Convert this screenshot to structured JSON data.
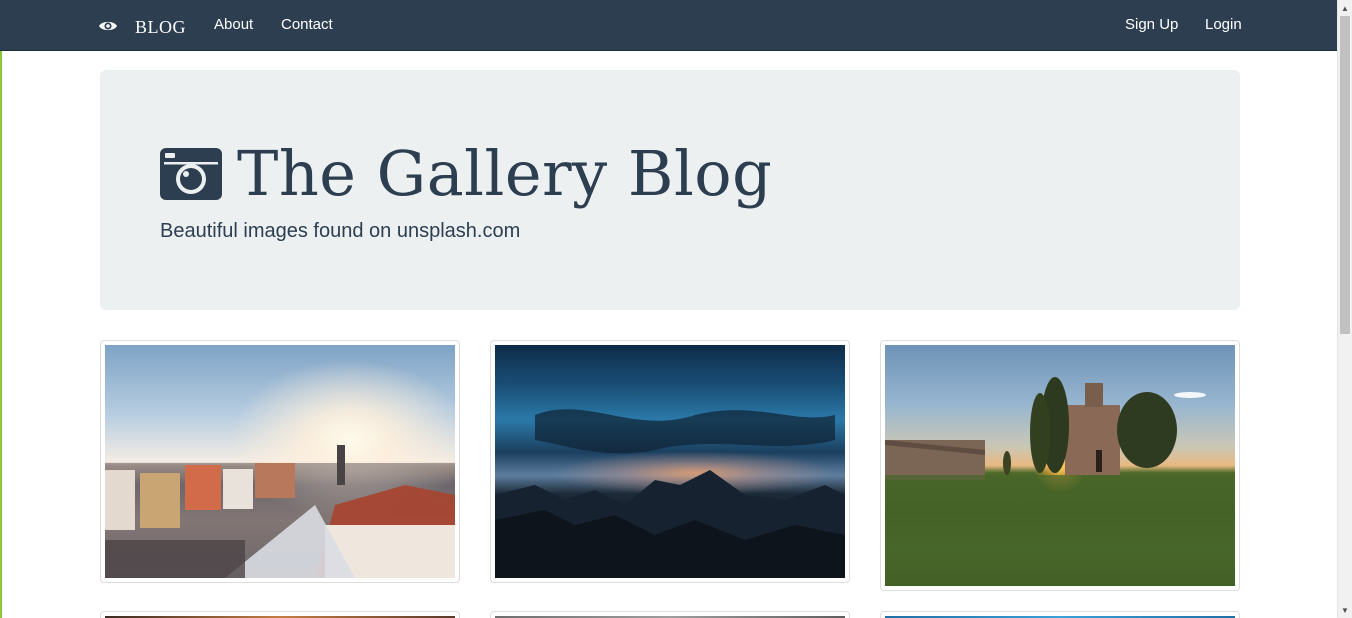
{
  "navbar": {
    "brand": "BLOG",
    "brand_icon": "eye-icon",
    "links_left": [
      "About",
      "Contact"
    ],
    "links_right": [
      "Sign Up",
      "Login"
    ],
    "background": "#2c3e50"
  },
  "hero": {
    "icon": "camera-icon",
    "title": "The Gallery Blog",
    "subtitle": "Beautiful images found on unsplash.com",
    "background": "#ecf0f1",
    "text_color": "#2c3e50"
  },
  "gallery": {
    "icons": [
      "town-sunset-photo",
      "blue-cloud-mountain-photo",
      "church-cypress-sunset-photo",
      "photo",
      "photo",
      "photo"
    ]
  },
  "colors": {
    "accent": "#2c3e50",
    "page_background": "#ffffff"
  }
}
